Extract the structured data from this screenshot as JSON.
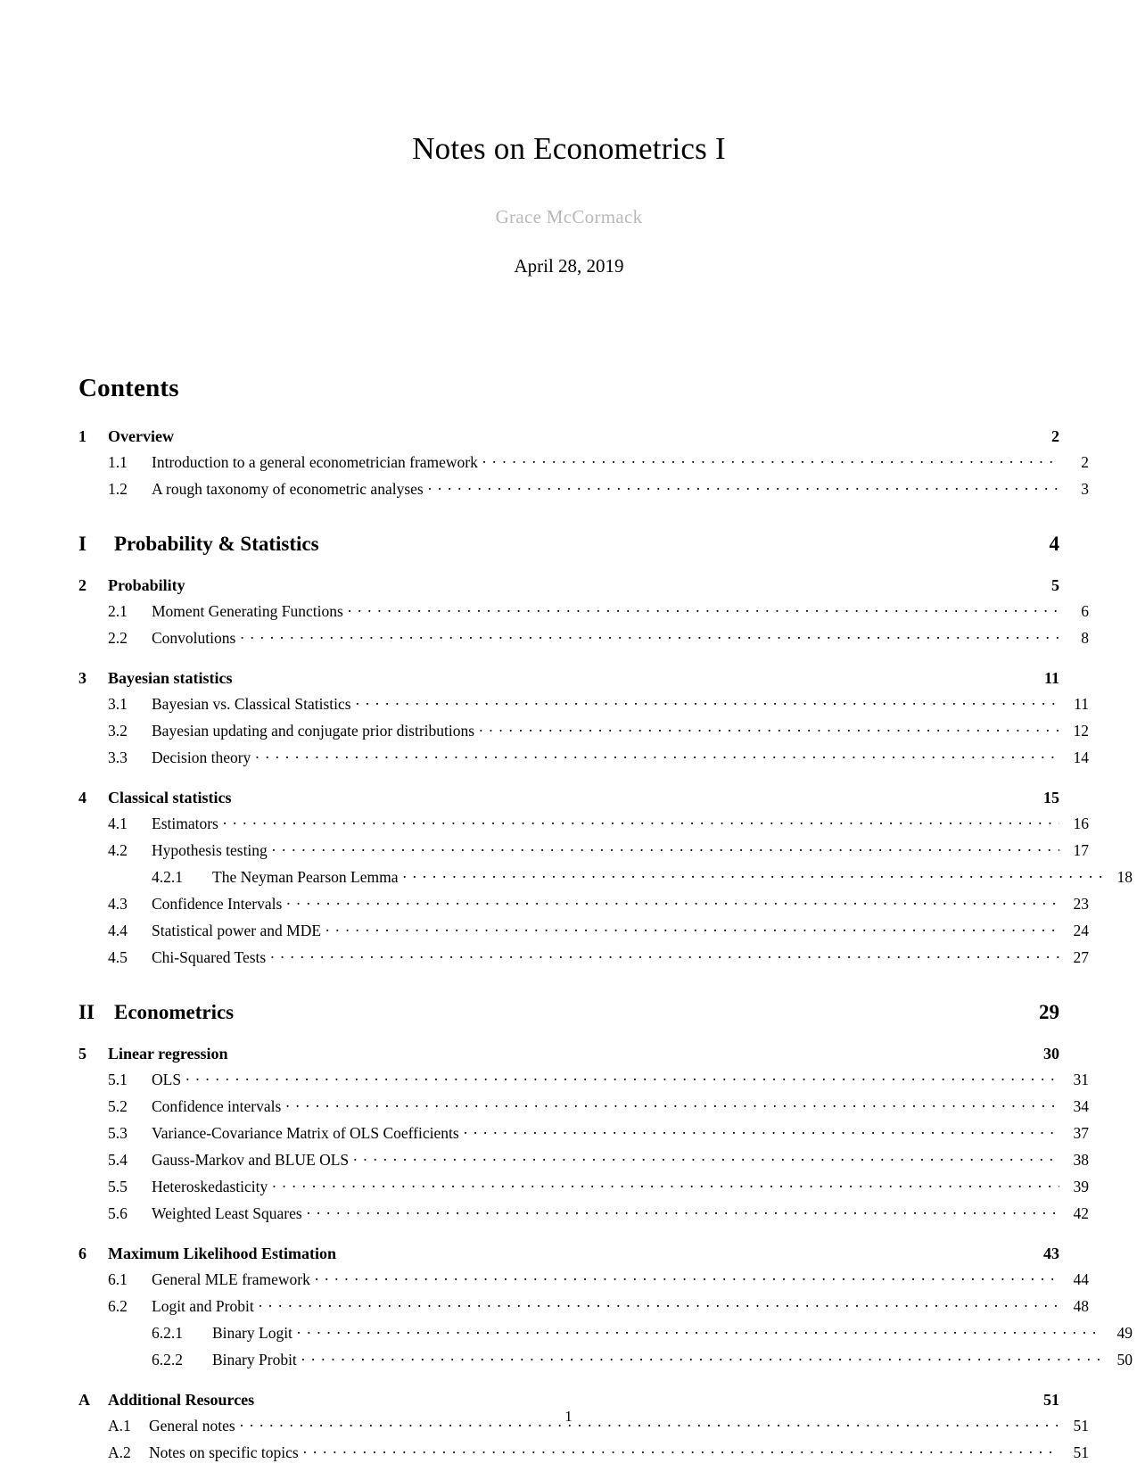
{
  "document": {
    "title": "Notes on Econometrics I",
    "author": "Grace McCormack",
    "date": "April 28, 2019",
    "contents_heading": "Contents",
    "footer_page_number": "1"
  },
  "toc": [
    {
      "level": "section",
      "number": "1",
      "label": "Overview",
      "page": "2"
    },
    {
      "level": "sub",
      "number": "1.1",
      "label": "Introduction to a general econometrician framework",
      "page": "2"
    },
    {
      "level": "sub",
      "number": "1.2",
      "label": "A rough taxonomy of econometric analyses",
      "page": "3"
    },
    {
      "level": "part",
      "number": "I",
      "label": "Probability & Statistics",
      "page": "4"
    },
    {
      "level": "section",
      "number": "2",
      "label": "Probability",
      "page": "5"
    },
    {
      "level": "sub",
      "number": "2.1",
      "label": "Moment Generating Functions",
      "page": "6"
    },
    {
      "level": "sub",
      "number": "2.2",
      "label": "Convolutions",
      "page": "8"
    },
    {
      "level": "section",
      "number": "3",
      "label": "Bayesian statistics",
      "page": "11"
    },
    {
      "level": "sub",
      "number": "3.1",
      "label": "Bayesian vs. Classical Statistics",
      "page": "11"
    },
    {
      "level": "sub",
      "number": "3.2",
      "label": "Bayesian updating and conjugate prior distributions",
      "page": "12"
    },
    {
      "level": "sub",
      "number": "3.3",
      "label": "Decision theory",
      "page": "14"
    },
    {
      "level": "section",
      "number": "4",
      "label": "Classical statistics",
      "page": "15"
    },
    {
      "level": "sub",
      "number": "4.1",
      "label": "Estimators",
      "page": "16"
    },
    {
      "level": "sub",
      "number": "4.2",
      "label": "Hypothesis testing",
      "page": "17"
    },
    {
      "level": "subsub",
      "number": "4.2.1",
      "label": "The Neyman Pearson Lemma",
      "page": "18"
    },
    {
      "level": "sub",
      "number": "4.3",
      "label": "Confidence Intervals",
      "page": "23"
    },
    {
      "level": "sub",
      "number": "4.4",
      "label": "Statistical power and MDE",
      "page": "24"
    },
    {
      "level": "sub",
      "number": "4.5",
      "label": "Chi-Squared Tests",
      "page": "27"
    },
    {
      "level": "part",
      "number": "II",
      "label": "Econometrics",
      "page": "29"
    },
    {
      "level": "section",
      "number": "5",
      "label": "Linear regression",
      "page": "30"
    },
    {
      "level": "sub",
      "number": "5.1",
      "label": "OLS",
      "page": "31"
    },
    {
      "level": "sub",
      "number": "5.2",
      "label": "Confidence intervals",
      "page": "34"
    },
    {
      "level": "sub",
      "number": "5.3",
      "label": "Variance-Covariance Matrix of OLS Coefficients",
      "page": "37"
    },
    {
      "level": "sub",
      "number": "5.4",
      "label": "Gauss-Markov and BLUE OLS",
      "page": "38"
    },
    {
      "level": "sub",
      "number": "5.5",
      "label": "Heteroskedasticity",
      "page": "39"
    },
    {
      "level": "sub",
      "number": "5.6",
      "label": "Weighted Least Squares",
      "page": "42"
    },
    {
      "level": "section",
      "number": "6",
      "label": "Maximum Likelihood Estimation",
      "page": "43"
    },
    {
      "level": "sub",
      "number": "6.1",
      "label": "General MLE framework",
      "page": "44"
    },
    {
      "level": "sub",
      "number": "6.2",
      "label": "Logit and Probit",
      "page": "48"
    },
    {
      "level": "subsub",
      "number": "6.2.1",
      "label": "Binary Logit",
      "page": "49"
    },
    {
      "level": "subsub",
      "number": "6.2.2",
      "label": "Binary Probit",
      "page": "50"
    },
    {
      "level": "section",
      "number": "A",
      "label": "Additional Resources",
      "page": "51"
    },
    {
      "level": "sub",
      "number": "A.1",
      "label": "General notes",
      "page": "51",
      "appendix": true
    },
    {
      "level": "sub",
      "number": "A.2",
      "label": "Notes on specific topics",
      "page": "51",
      "appendix": true
    }
  ]
}
